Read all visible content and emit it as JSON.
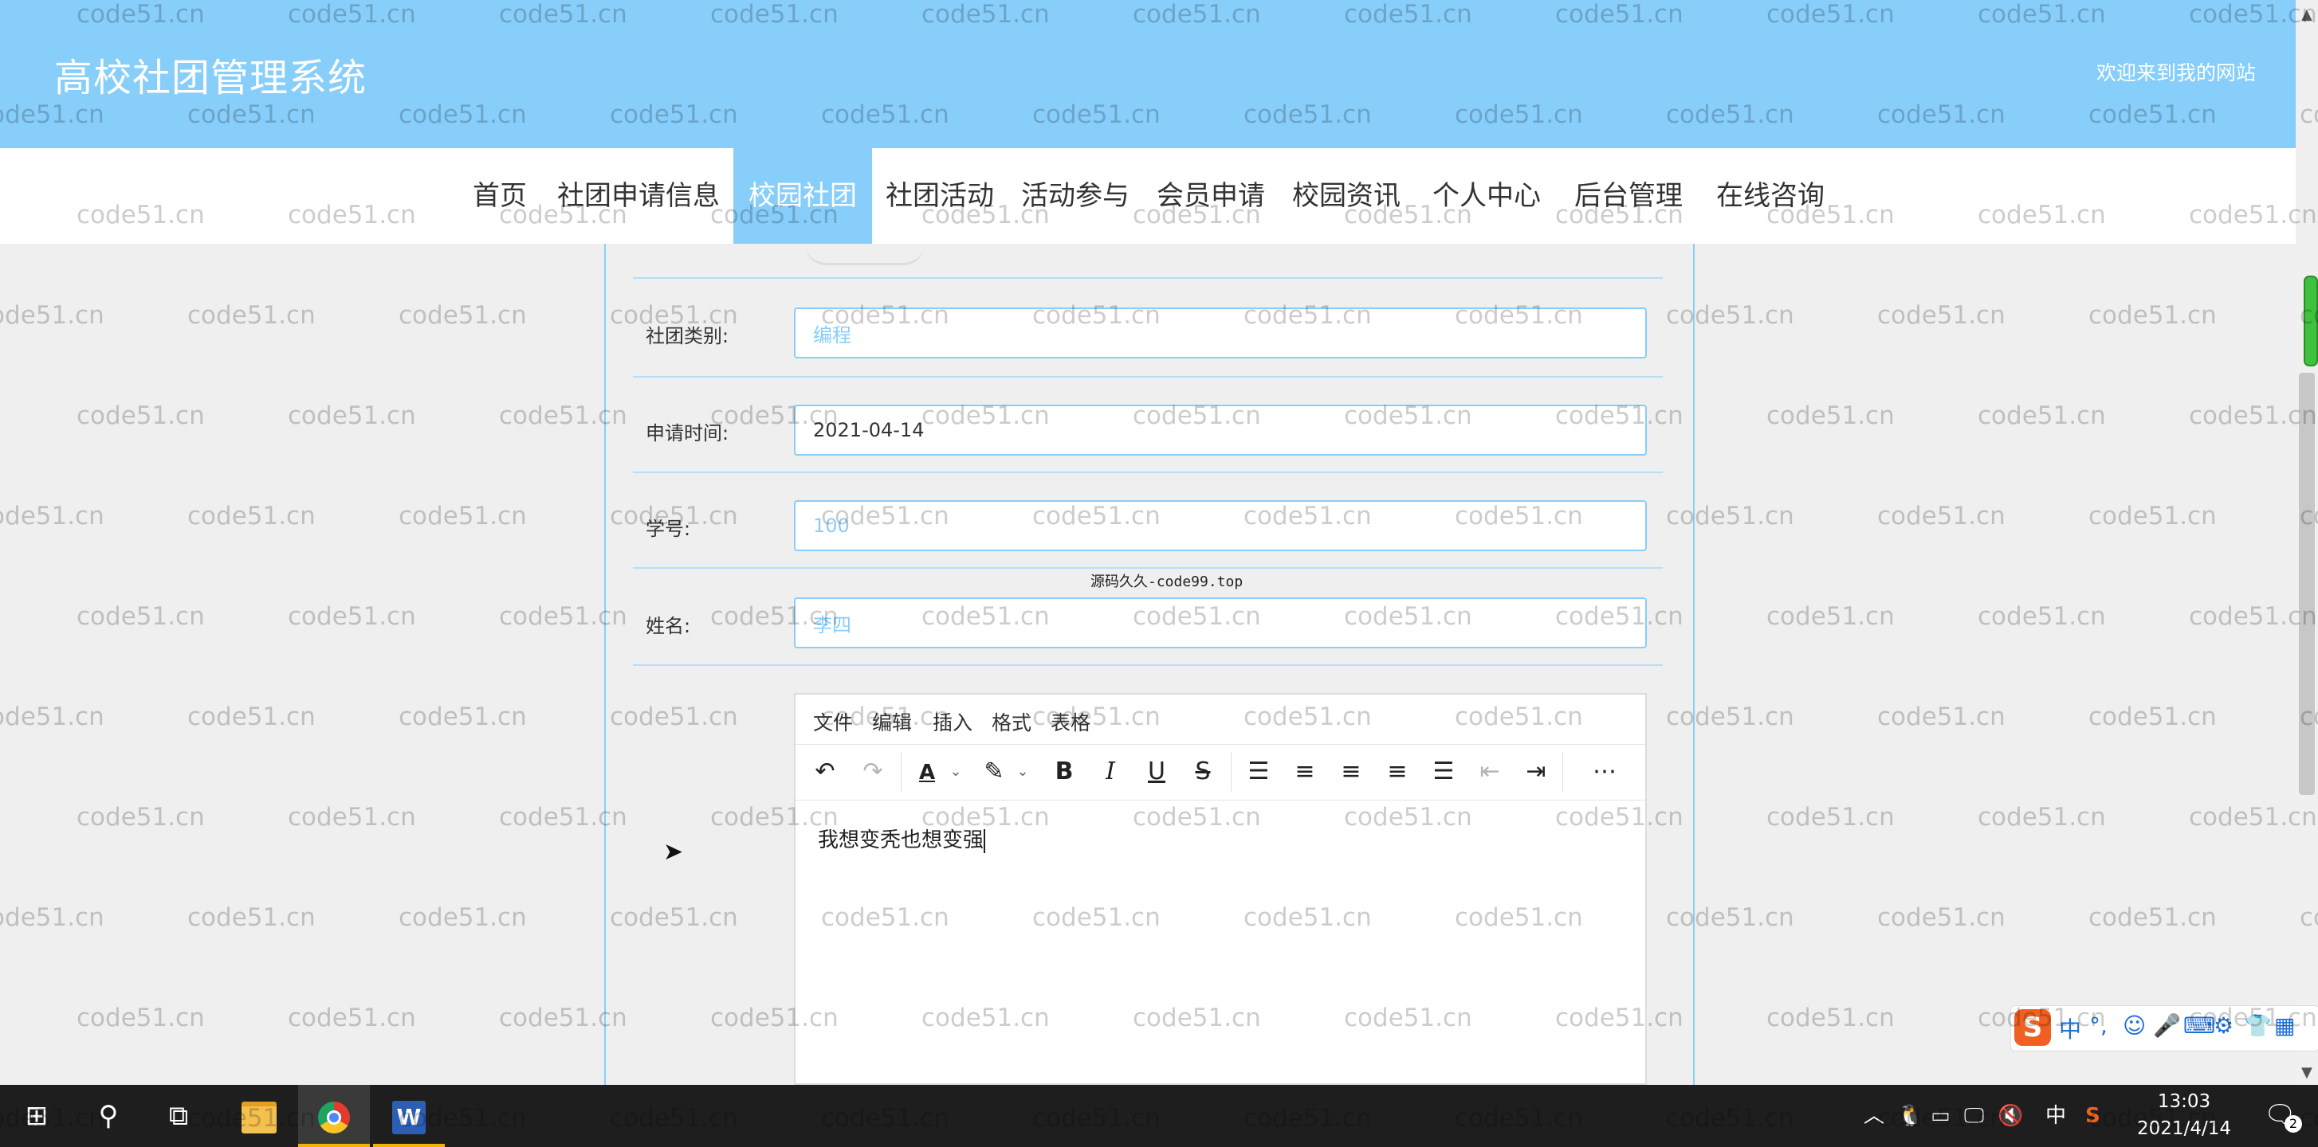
{
  "header": {
    "title": "高校社团管理系统",
    "welcome": "欢迎来到我的网站"
  },
  "nav": {
    "items": [
      "首页",
      "社团申请信息",
      "校园社团",
      "社团活动",
      "活动参与",
      "会员申请",
      "校园资讯",
      "个人中心",
      "后台管理",
      "在线咨询"
    ],
    "active": "校园社团"
  },
  "form": {
    "category": {
      "label": "社团类别:",
      "value": "编程"
    },
    "apply_time": {
      "label": "申请时间:",
      "value": "2021-04-14"
    },
    "student_id": {
      "label": "学号:",
      "value": "100"
    },
    "name": {
      "label": "姓名:",
      "value": "李四"
    }
  },
  "center_watermark": "源码久久-code99.top",
  "editor": {
    "menus": [
      "文件",
      "编辑",
      "插入",
      "格式",
      "表格"
    ],
    "toolbar": [
      "undo-icon",
      "redo-icon",
      "text-color-icon",
      "highlight-icon",
      "bold-icon",
      "italic-icon",
      "underline-icon",
      "strikethrough-icon",
      "bullet-list-icon",
      "align-left-icon",
      "align-center-icon",
      "align-right-icon",
      "justify-icon",
      "outdent-icon",
      "indent-icon",
      "more-icon"
    ],
    "content": "我想变秃也想变强"
  },
  "ime": {
    "mode": "中"
  },
  "taskbar": {
    "time": "13:03",
    "date": "2021/4/14",
    "tray_lang": "中",
    "notifications": "2"
  },
  "watermark_text": "code51.cn",
  "colors": {
    "header": "#87cefa",
    "accent": "#87cefa",
    "taskbar": "#1e1e1e"
  }
}
